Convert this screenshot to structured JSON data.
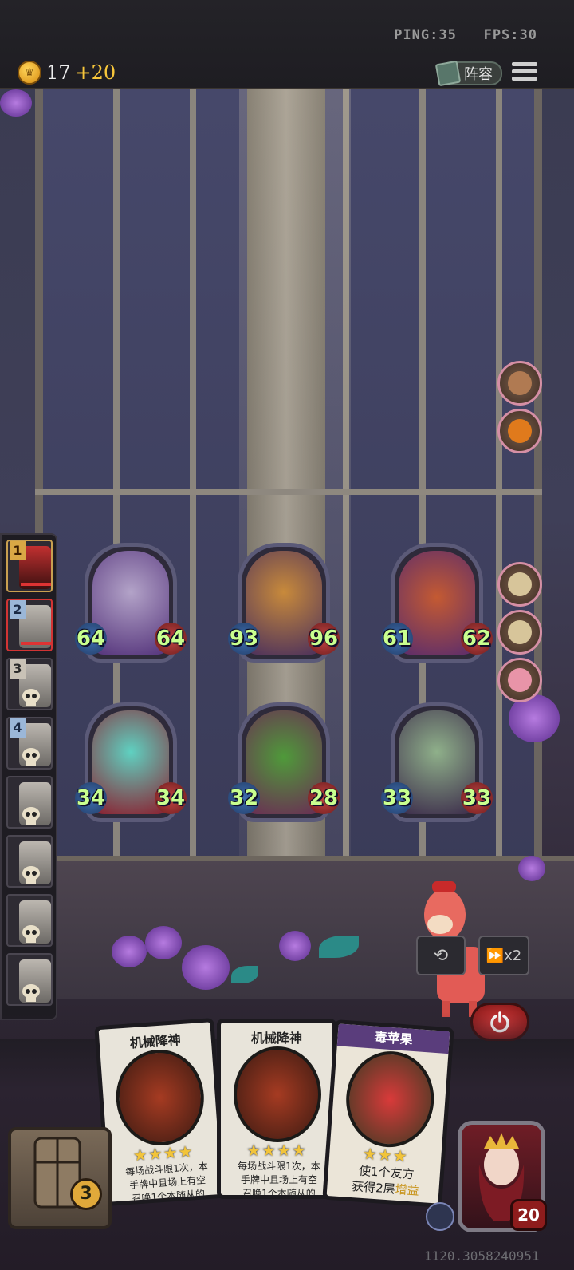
{
  "hud": {
    "ping": "PING:35",
    "fps": "FPS:30",
    "coins": "17",
    "coin_bonus": "+20",
    "lineup_label": "阵容"
  },
  "roster": [
    {
      "num": "1",
      "state": "active"
    },
    {
      "num": "2",
      "state": "selected"
    },
    {
      "num": "3",
      "state": "dead"
    },
    {
      "num": "4",
      "state": "dead"
    },
    {
      "num": "",
      "state": "dead"
    },
    {
      "num": "",
      "state": "dead"
    },
    {
      "num": "",
      "state": "dead"
    },
    {
      "num": "",
      "state": "dead"
    }
  ],
  "minions": [
    {
      "name": "skeleton-mage",
      "attack": "64",
      "health": "64"
    },
    {
      "name": "pumpkin-golem",
      "attack": "93",
      "health": "96"
    },
    {
      "name": "siege-engine",
      "attack": "61",
      "health": "62"
    },
    {
      "name": "ghost-ogre",
      "attack": "34",
      "health": "34"
    },
    {
      "name": "green-dragon",
      "attack": "32",
      "health": "28"
    },
    {
      "name": "horned-witch",
      "attack": "33",
      "health": "33"
    }
  ],
  "controls": {
    "speed_label": "x2"
  },
  "hand": [
    {
      "title": "机械降神",
      "stars": "★★★★",
      "text_line1": "每场战斗限1次，本",
      "text_line2": "手牌中且场上有空",
      "text_line3": "召唤1个本随从的"
    },
    {
      "title": "机械降神",
      "stars": "★★★★",
      "text_line1": "每场战斗限1次，本",
      "text_line2": "手牌中且场上有空",
      "text_line3": "召唤1个本随从的"
    },
    {
      "title": "毒苹果",
      "stars": "★★★",
      "text_line1": "使1个友方",
      "text_line2": "获得2层",
      "text_keyword": "增益"
    }
  ],
  "deck_count": "3",
  "hero_health": "20",
  "coords": "1120.3058240951"
}
